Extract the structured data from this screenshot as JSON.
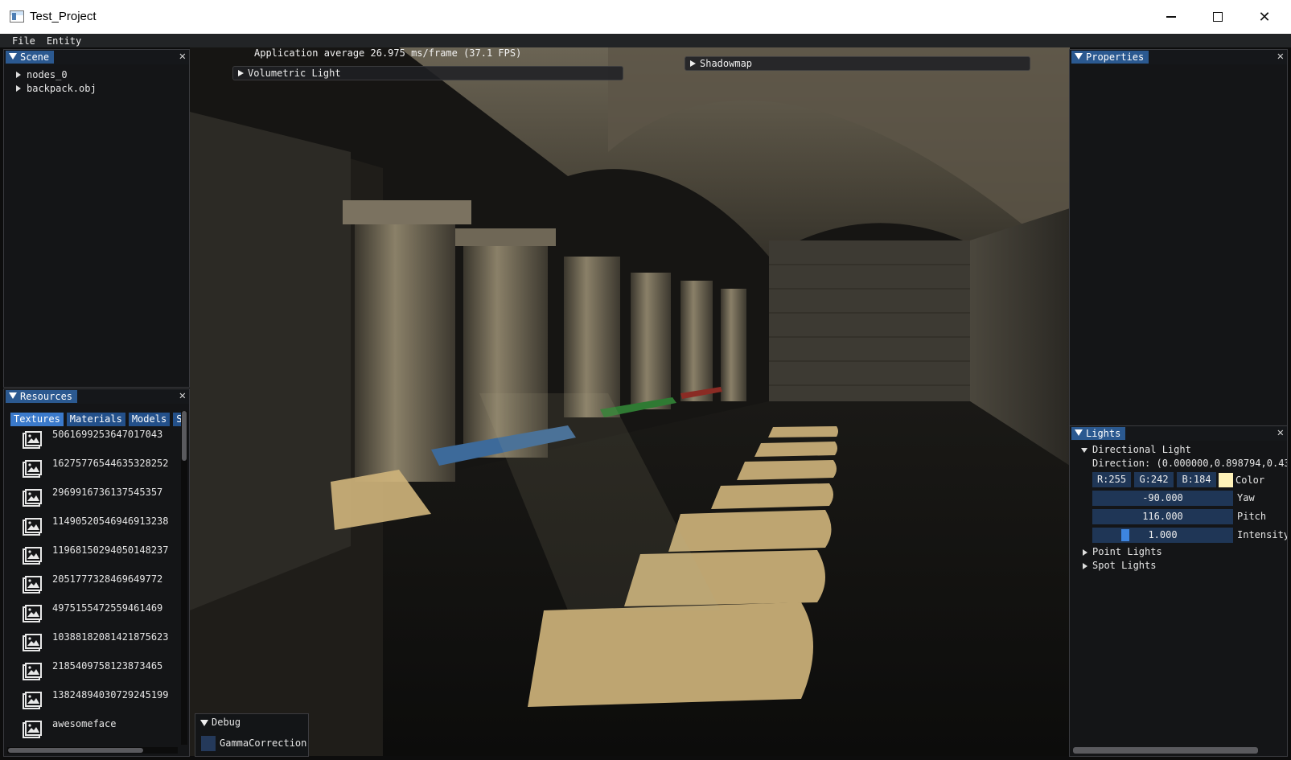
{
  "window": {
    "title": "Test_Project"
  },
  "menu": [
    "File",
    "Entity"
  ],
  "scene": {
    "title": "Scene",
    "items": [
      "nodes_0",
      "backpack.obj"
    ]
  },
  "resources": {
    "title": "Resources",
    "tabs": [
      "Textures",
      "Materials",
      "Models",
      "S"
    ],
    "items": [
      "5061699253647017043",
      "16275776544635328252",
      "2969916736137545357",
      "11490520546946913238",
      "11968150294050148237",
      "2051777328469649772",
      "4975155472559461469",
      "10388182081421875623",
      "2185409758123873465",
      "13824894030729245199",
      "awesomeface"
    ]
  },
  "overlay": {
    "fps": "Application average 26.975 ms/frame (37.1 FPS)",
    "volumetric": "Volumetric Light",
    "shadowmap": "Shadowmap"
  },
  "debug": {
    "title": "Debug",
    "option": "GammaCorrection"
  },
  "properties": {
    "title": "Properties"
  },
  "lights": {
    "title": "Lights",
    "directional": "Directional Light",
    "direction": "Direction: (0.000000,0.898794,0.43",
    "r": "R:255",
    "g": "G:242",
    "b": "B:184",
    "color_label": "Color",
    "yaw": "-90.000",
    "yaw_label": "Yaw",
    "pitch": "116.000",
    "pitch_label": "Pitch",
    "intensity": "1.000",
    "intensity_label": "Intensity",
    "point": "Point Lights",
    "spot": "Spot Lights",
    "color_hex": "#fff2b8"
  }
}
